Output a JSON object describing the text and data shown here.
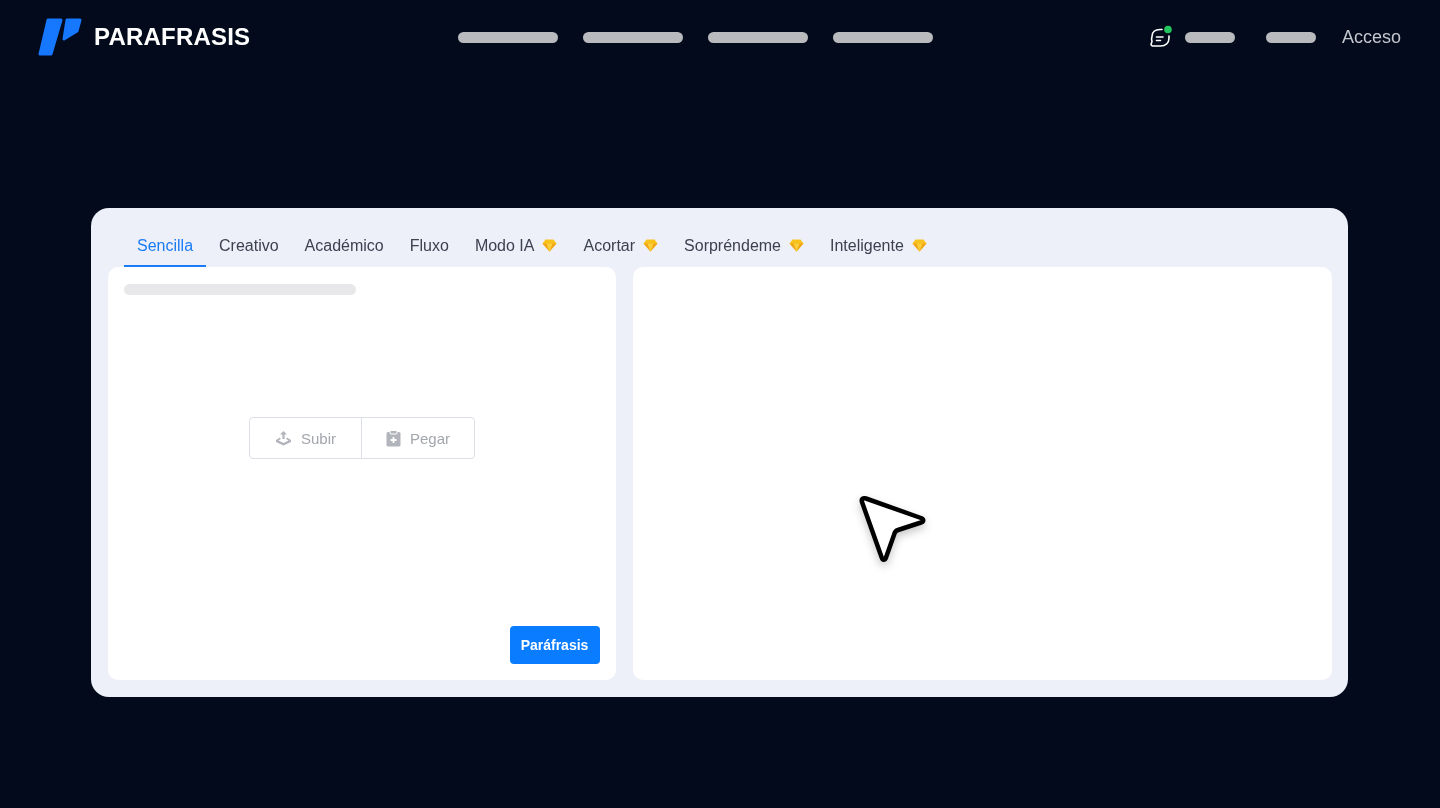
{
  "header": {
    "brand": "PARAFRASIS",
    "chat_unread": true,
    "login_link": "Acceso"
  },
  "tabs": [
    {
      "label": "Sencilla",
      "selected": true,
      "premium": false
    },
    {
      "label": "Creativo",
      "selected": false,
      "premium": false
    },
    {
      "label": "Académico",
      "selected": false,
      "premium": false
    },
    {
      "label": "Fluxo",
      "selected": false,
      "premium": false
    },
    {
      "label": "Modo IA",
      "selected": false,
      "premium": true
    },
    {
      "label": "Acortar",
      "selected": false,
      "premium": true
    },
    {
      "label": "Sorpréndeme",
      "selected": false,
      "premium": true
    },
    {
      "label": "Inteligente",
      "selected": false,
      "premium": true
    }
  ],
  "editor": {
    "actions": [
      {
        "kind": "upload",
        "label": "Subir"
      },
      {
        "kind": "paste",
        "label": "Pegar"
      }
    ],
    "submit_label": "Paráfrasis"
  }
}
